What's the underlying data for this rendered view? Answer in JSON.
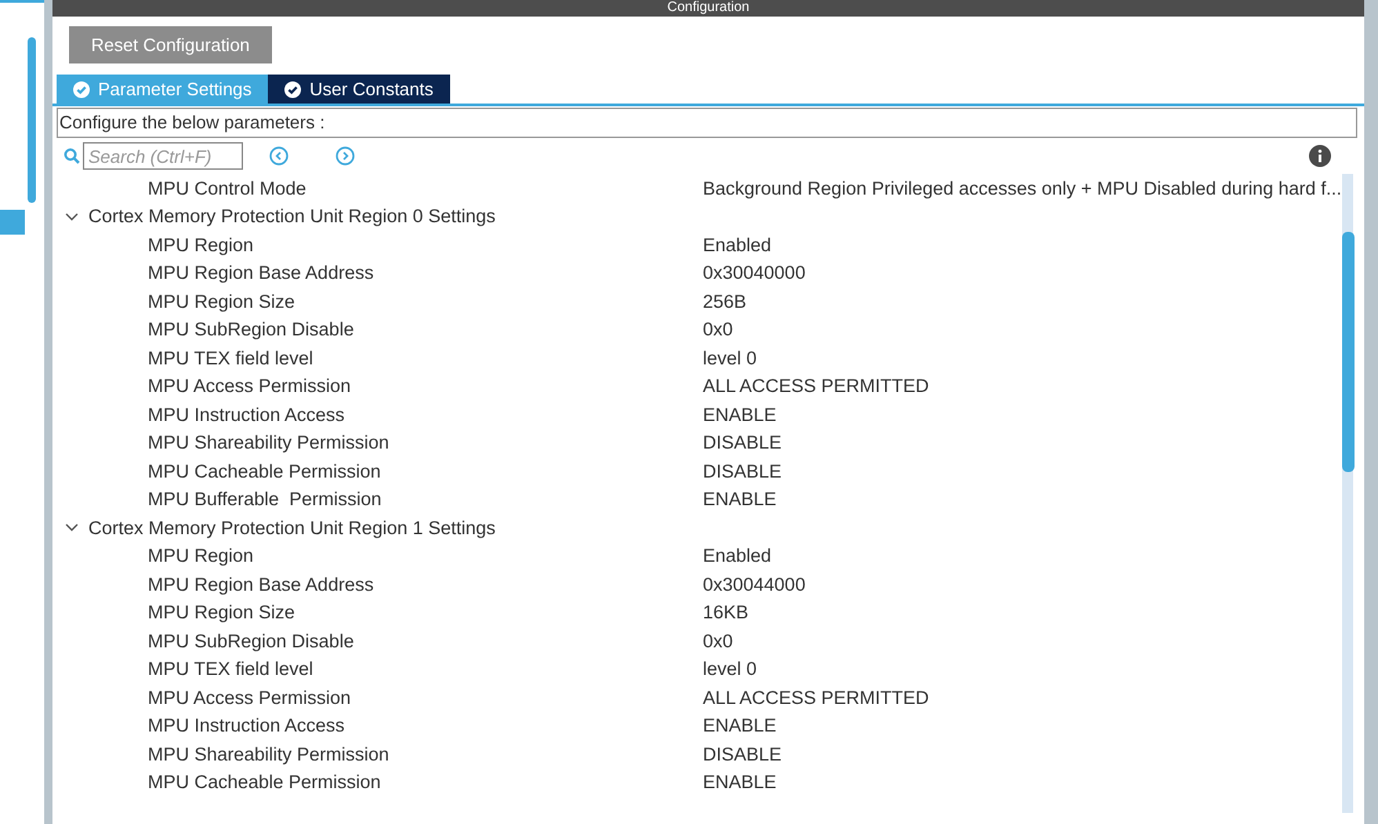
{
  "window": {
    "title": "Configuration"
  },
  "reset_button": "Reset Configuration",
  "tabs": [
    {
      "label": "Parameter Settings",
      "selected": true
    },
    {
      "label": "User Constants",
      "selected": false
    }
  ],
  "instruction": "Configure the below parameters :",
  "search": {
    "placeholder": "Search (Ctrl+F)"
  },
  "parameters": [
    {
      "kind": "param",
      "label": "MPU Control Mode",
      "value": "Background Region Privileged accesses only + MPU Disabled during hard f..."
    },
    {
      "kind": "group",
      "label": "Cortex Memory Protection Unit Region 0 Settings",
      "expanded": true,
      "children": [
        {
          "kind": "param",
          "label": "MPU Region",
          "value": "Enabled"
        },
        {
          "kind": "param",
          "label": "MPU Region Base Address",
          "value": "0x30040000"
        },
        {
          "kind": "param",
          "label": "MPU Region Size",
          "value": "256B"
        },
        {
          "kind": "param",
          "label": "MPU SubRegion Disable",
          "value": "0x0"
        },
        {
          "kind": "param",
          "label": "MPU TEX field level",
          "value": "level 0"
        },
        {
          "kind": "param",
          "label": "MPU Access Permission",
          "value": "ALL ACCESS PERMITTED"
        },
        {
          "kind": "param",
          "label": "MPU Instruction Access",
          "value": "ENABLE"
        },
        {
          "kind": "param",
          "label": "MPU Shareability Permission",
          "value": "DISABLE"
        },
        {
          "kind": "param",
          "label": "MPU Cacheable Permission",
          "value": "DISABLE"
        },
        {
          "kind": "param",
          "label": "MPU Bufferable  Permission",
          "value": "ENABLE"
        }
      ]
    },
    {
      "kind": "group",
      "label": "Cortex Memory Protection Unit Region 1 Settings",
      "expanded": true,
      "children": [
        {
          "kind": "param",
          "label": "MPU Region",
          "value": "Enabled"
        },
        {
          "kind": "param",
          "label": "MPU Region Base Address",
          "value": "0x30044000"
        },
        {
          "kind": "param",
          "label": "MPU Region Size",
          "value": "16KB"
        },
        {
          "kind": "param",
          "label": "MPU SubRegion Disable",
          "value": "0x0"
        },
        {
          "kind": "param",
          "label": "MPU TEX field level",
          "value": "level 0"
        },
        {
          "kind": "param",
          "label": "MPU Access Permission",
          "value": "ALL ACCESS PERMITTED"
        },
        {
          "kind": "param",
          "label": "MPU Instruction Access",
          "value": "ENABLE"
        },
        {
          "kind": "param",
          "label": "MPU Shareability Permission",
          "value": "DISABLE"
        },
        {
          "kind": "param",
          "label": "MPU Cacheable Permission",
          "value": "ENABLE"
        }
      ]
    }
  ]
}
